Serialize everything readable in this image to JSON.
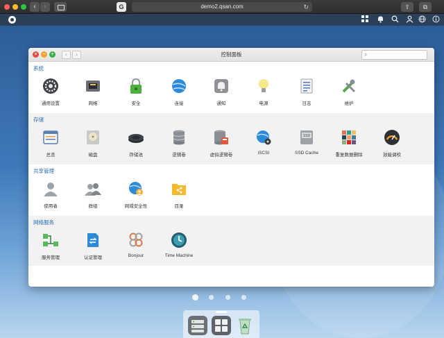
{
  "browser": {
    "url": "demo2.qsan.com",
    "site_icon_glyph": "G",
    "nav_back": "‹",
    "nav_forward": "›",
    "reload_glyph": "↻",
    "share_glyph": "⇧",
    "tabs_glyph": "⧉"
  },
  "app_header": {
    "icons": [
      "grid-icon",
      "bell-icon",
      "search-icon",
      "user-icon",
      "globe-icon",
      "info-icon"
    ]
  },
  "window": {
    "title": "控制面板",
    "search_placeholder": "",
    "search_glyph": "⌕",
    "close_glyph": "×",
    "min_glyph": "−",
    "max_glyph": "+",
    "back_glyph": "‹",
    "forward_glyph": "›",
    "sections": [
      {
        "title": "系统",
        "items": [
          {
            "label": "通用设置",
            "icon": "gear-icon"
          },
          {
            "label": "网络",
            "icon": "network-port-icon"
          },
          {
            "label": "安全",
            "icon": "lock-icon"
          },
          {
            "label": "连接",
            "icon": "globe-connect-icon"
          },
          {
            "label": "通知",
            "icon": "notification-icon"
          },
          {
            "label": "电源",
            "icon": "lightbulb-icon"
          },
          {
            "label": "日志",
            "icon": "log-icon"
          },
          {
            "label": "维护",
            "icon": "tools-icon"
          }
        ]
      },
      {
        "title": "存储",
        "items": [
          {
            "label": "总览",
            "icon": "overview-icon"
          },
          {
            "label": "磁盘",
            "icon": "disk-icon"
          },
          {
            "label": "存储池",
            "icon": "pool-icon"
          },
          {
            "label": "逻辑卷",
            "icon": "volume-icon"
          },
          {
            "label": "虚拟逻辑卷",
            "icon": "virtual-volume-icon"
          },
          {
            "label": "iSCSI",
            "icon": "iscsi-icon"
          },
          {
            "label": "SSD Cache",
            "icon": "ssd-icon"
          },
          {
            "label": "重复数据删除",
            "icon": "dedup-icon"
          },
          {
            "label": "效能调校",
            "icon": "gauge-icon"
          }
        ]
      },
      {
        "title": "共享管理",
        "items": [
          {
            "label": "使用者",
            "icon": "user-icon"
          },
          {
            "label": "群组",
            "icon": "group-icon"
          },
          {
            "label": "网域安全性",
            "icon": "domain-security-icon"
          },
          {
            "label": "目录",
            "icon": "folder-share-icon"
          }
        ]
      },
      {
        "title": "网络服务",
        "items": [
          {
            "label": "服务管理",
            "icon": "service-icon"
          },
          {
            "label": "认证管理",
            "icon": "certificate-icon"
          },
          {
            "label": "Bonjour",
            "icon": "bonjour-icon"
          },
          {
            "label": "Time Machine",
            "icon": "time-machine-icon"
          }
        ]
      }
    ]
  },
  "pagination": {
    "pages": 4,
    "active": 0
  },
  "dock": {
    "items": [
      "storage-app-icon",
      "control-panel-app-icon",
      "recycle-bin-icon"
    ]
  },
  "colors": {
    "section_title": "#2d6cb1",
    "header_bg": "#2b3f57",
    "window_bg": "#ffffff",
    "section_alt_bg": "#f2f2f2"
  }
}
